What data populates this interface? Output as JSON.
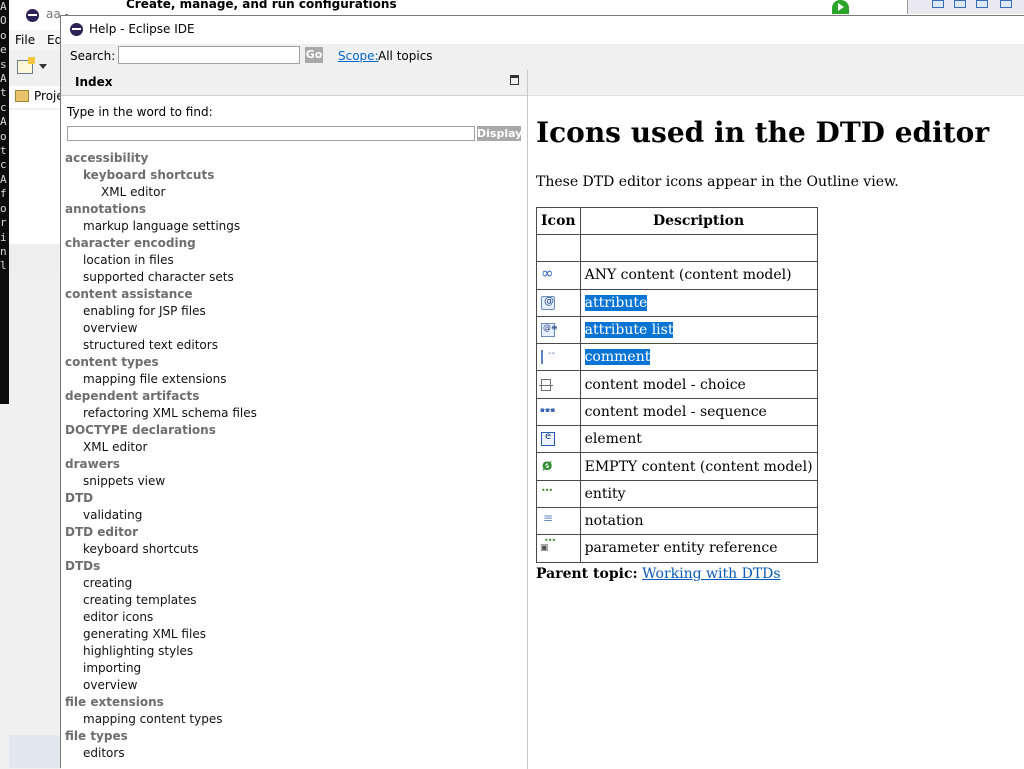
{
  "background_window": {
    "title": "aa - Eclipse IDE",
    "menu": [
      "File",
      "Ed"
    ],
    "project_tab_label": "Proje",
    "console_chars": [
      "A",
      "O",
      "o",
      "e",
      "",
      "",
      "",
      "s",
      "A",
      "t",
      "c",
      "A",
      "o",
      "t",
      "c",
      "A",
      "f",
      "o",
      "r",
      "i",
      "n",
      "l"
    ]
  },
  "launch_dialog": {
    "title": "Create, manage, and run configurations"
  },
  "help_window": {
    "title": "Help - Eclipse IDE",
    "search": {
      "label": "Search:",
      "value": "",
      "go_label": "Go",
      "scope_link": "Scope:",
      "scope_value": "All topics"
    },
    "index": {
      "title": "Index",
      "find_label": "Type in the word to find:",
      "find_value": "",
      "display_label": "Display",
      "entries": [
        {
          "text": "accessibility",
          "level": 0
        },
        {
          "text": "keyboard shortcuts",
          "level": 1,
          "bold": true
        },
        {
          "text": "XML editor",
          "level": 2
        },
        {
          "text": "annotations",
          "level": 0
        },
        {
          "text": "markup language settings",
          "level": 1
        },
        {
          "text": "character encoding",
          "level": 0
        },
        {
          "text": "location in files",
          "level": 1
        },
        {
          "text": "supported character sets",
          "level": 1
        },
        {
          "text": "content assistance",
          "level": 0
        },
        {
          "text": "enabling for JSP files",
          "level": 1
        },
        {
          "text": "overview",
          "level": 1
        },
        {
          "text": "structured text editors",
          "level": 1
        },
        {
          "text": "content types",
          "level": 0
        },
        {
          "text": "mapping file extensions",
          "level": 1
        },
        {
          "text": "dependent artifacts",
          "level": 0
        },
        {
          "text": "refactoring XML schema files",
          "level": 1
        },
        {
          "text": "DOCTYPE declarations",
          "level": 0
        },
        {
          "text": "XML editor",
          "level": 1
        },
        {
          "text": "drawers",
          "level": 0
        },
        {
          "text": "snippets view",
          "level": 1
        },
        {
          "text": "DTD",
          "level": 0
        },
        {
          "text": "validating",
          "level": 1
        },
        {
          "text": "DTD editor",
          "level": 0
        },
        {
          "text": "keyboard shortcuts",
          "level": 1
        },
        {
          "text": "DTDs",
          "level": 0
        },
        {
          "text": "creating",
          "level": 1
        },
        {
          "text": "creating templates",
          "level": 1
        },
        {
          "text": "editor icons",
          "level": 1
        },
        {
          "text": "generating XML files",
          "level": 1
        },
        {
          "text": "highlighting styles",
          "level": 1
        },
        {
          "text": "importing",
          "level": 1
        },
        {
          "text": "overview",
          "level": 1
        },
        {
          "text": "file extensions",
          "level": 0
        },
        {
          "text": "mapping content types",
          "level": 1
        },
        {
          "text": "file types",
          "level": 0
        },
        {
          "text": "editors",
          "level": 1
        }
      ]
    },
    "content": {
      "title": "Icons used in the DTD editor",
      "intro": "These DTD editor icons appear in the Outline view.",
      "table_headers": {
        "icon": "Icon",
        "description": "Description"
      },
      "rows": [
        {
          "icon": "",
          "description": "",
          "selected": false
        },
        {
          "icon": "any-content-icon",
          "description": "ANY content (content model)",
          "selected": false
        },
        {
          "icon": "attribute-icon",
          "description": "attribute",
          "selected": true
        },
        {
          "icon": "attribute-list-icon",
          "description": "attribute list",
          "selected": true
        },
        {
          "icon": "comment-icon",
          "description": "comment",
          "selected": true
        },
        {
          "icon": "content-model-choice-icon",
          "description": "content model - choice",
          "selected": false
        },
        {
          "icon": "content-model-sequence-icon",
          "description": "content model - sequence",
          "selected": false
        },
        {
          "icon": "element-icon",
          "description": "element",
          "selected": false
        },
        {
          "icon": "empty-content-icon",
          "description": "EMPTY content (content model)",
          "selected": false
        },
        {
          "icon": "entity-icon",
          "description": "entity",
          "selected": false
        },
        {
          "icon": "notation-icon",
          "description": "notation",
          "selected": false
        },
        {
          "icon": "parameter-entity-reference-icon",
          "description": "parameter entity reference",
          "selected": false
        }
      ],
      "parent_topic_label": "Parent topic:",
      "parent_topic_link": "Working with DTDs"
    }
  },
  "colors": {
    "selection": "#0a74d4",
    "link": "#0066cc",
    "index_heading": "#6e6e6e"
  }
}
